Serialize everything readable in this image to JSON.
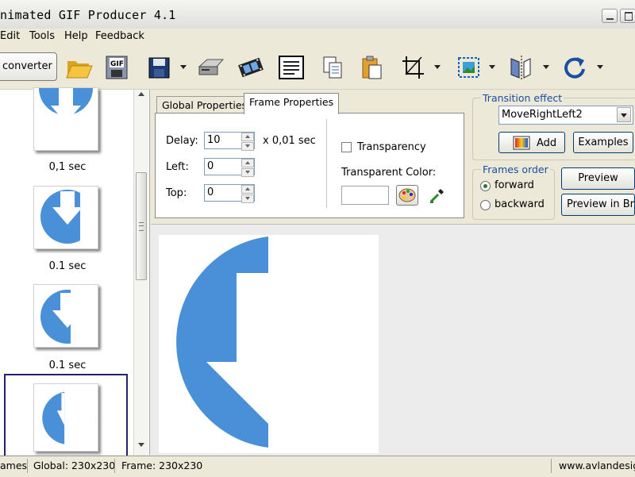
{
  "window": {
    "title": "nimated GIF Producer 4.1"
  },
  "menu": {
    "items": [
      "Edit",
      "Tools",
      "Help",
      "Feedback"
    ]
  },
  "toolbar": {
    "converter_label": "converter",
    "icons": [
      "open-folder-icon",
      "gif-icon",
      "save-icon",
      "scanner-icon",
      "film-icon",
      "text-document-icon",
      "copy-icon",
      "paste-icon",
      "crop-icon",
      "resize-icon",
      "flip-icon",
      "rotate-icon"
    ]
  },
  "frames": [
    {
      "delay": "0,1 sec"
    },
    {
      "delay": "0.1 sec"
    },
    {
      "delay": "0.1 sec"
    },
    {
      "delay": ""
    }
  ],
  "tabs": {
    "global": "Global Properties",
    "frame": "Frame Properties"
  },
  "frame_props": {
    "delay_label": "Delay:",
    "delay_value": "10",
    "delay_unit": "x 0,01 sec",
    "left_label": "Left:",
    "left_value": "0",
    "top_label": "Top:",
    "top_value": "0",
    "transparency_label": "Transparency",
    "transparent_color_label": "Transparent Color:"
  },
  "transition": {
    "group_title": "Transition effect",
    "selected": "MoveRightLeft2",
    "add_label": "Add",
    "examples_label": "Examples"
  },
  "frames_order": {
    "group_title": "Frames order",
    "forward": "forward",
    "backward": "backward",
    "selected": "forward"
  },
  "preview": {
    "preview_label": "Preview",
    "preview_browser_label": "Preview in Brow"
  },
  "status": {
    "frames": "ames",
    "global": "Global: 230x230",
    "frame": "Frame: 230x230",
    "website": "www.avlandesign"
  },
  "colors": {
    "shape_blue": "#4a90d9",
    "group_title": "#1a4ea0"
  }
}
